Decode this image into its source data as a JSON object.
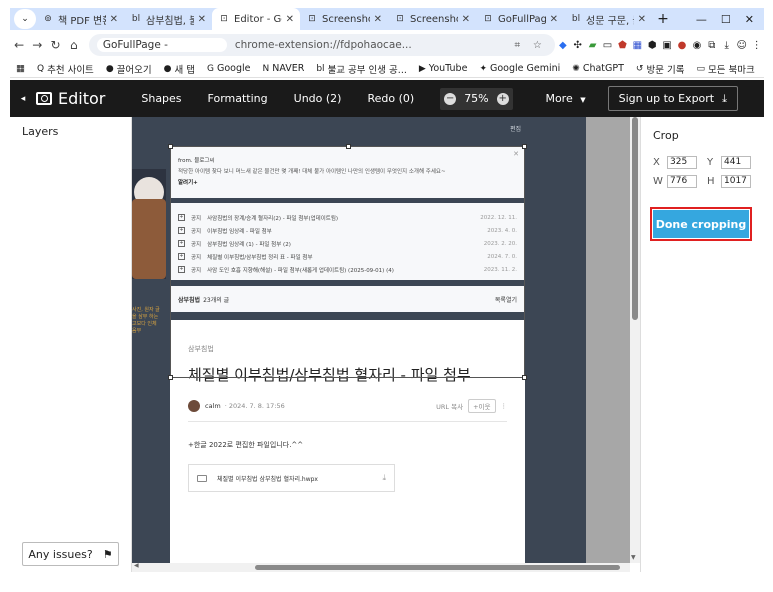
{
  "browser": {
    "tabs": [
      {
        "icon": "⊚",
        "label": "책 PDF 변환",
        "active": false
      },
      {
        "icon": "bl",
        "label": "삼부침법, 불",
        "active": false
      },
      {
        "icon": "⊡",
        "label": "Editor - GoF",
        "active": true
      },
      {
        "icon": "⊡",
        "label": "Screenshot",
        "active": false
      },
      {
        "icon": "⊡",
        "label": "Screenshot",
        "active": false
      },
      {
        "icon": "⊡",
        "label": "GoFullPage",
        "active": false
      },
      {
        "icon": "bl",
        "label": "성문 구문, 불",
        "active": false
      }
    ],
    "omnibox": {
      "site": "GoFullPage -",
      "url": "chrome-extension://fdpohaocae..."
    },
    "bookmarks": [
      {
        "icon": "Q",
        "label": "추천 사이트"
      },
      {
        "icon": "●",
        "label": "끌어오기"
      },
      {
        "icon": "●",
        "label": "새 탭"
      },
      {
        "icon": "G",
        "label": "Google"
      },
      {
        "icon": "N",
        "label": "NAVER"
      },
      {
        "icon": "bl",
        "label": "불교 공부 인생 공..."
      },
      {
        "icon": "▶",
        "label": "YouTube"
      },
      {
        "icon": "✦",
        "label": "Google Gemini"
      },
      {
        "icon": "✺",
        "label": "ChatGPT"
      },
      {
        "icon": "↺",
        "label": "방문 기록"
      }
    ],
    "bookmarks_all": "모든 북마크"
  },
  "editor": {
    "title": "Editor",
    "menu": {
      "shapes": "Shapes",
      "formatting": "Formatting",
      "undo": "Undo (2)",
      "redo": "Redo (0)"
    },
    "zoom": "75%",
    "more": "More",
    "export": "Sign up to Export"
  },
  "layers": {
    "title": "Layers",
    "issues": "Any issues?"
  },
  "canvas": {
    "badge": "편집",
    "card1": {
      "from": "from. 블로그씨",
      "desc": "적당한 아이템 찾다 보니 머느새 같은 물건만 몇 개째! 대체 불가 아이템인 나만의 인생템이 무엇인지 소개해 주세요~",
      "more": "알려기+"
    },
    "list": [
      {
        "cat": "공지",
        "title": "사암침법의 장계/승계 혈자리(2) - 파일 첨부(업데이트됨)",
        "date": "2022. 12. 11."
      },
      {
        "cat": "공지",
        "title": "이부침법 임상례 - 파일 첨부",
        "date": "2023. 4. 0."
      },
      {
        "cat": "공지",
        "title": "삼부침법 임상례 (1) - 파일 첨부 (2)",
        "date": "2023. 2. 20."
      },
      {
        "cat": "공지",
        "title": "체질별 이부침법/삼부침법 정리 표 - 파일 첨부",
        "date": "2024. 7. 0."
      },
      {
        "cat": "공지",
        "title": "사암 도인 호흡 지향해(해설) - 파일 첨부(새롭게 업데이트됨) (2025-09-01) (4)",
        "date": "2023. 11. 2."
      }
    ],
    "card3": {
      "cat": "삼부침법",
      "count": "23개의 글",
      "toggle": "목록열기"
    },
    "post": {
      "category": "삼부침법",
      "title": "체질별 이부침법/삼부침법 혈자리 - 파일 첨부",
      "author": "calm",
      "date": "· 2024. 7. 8. 17:56",
      "url_copy": "URL 복사",
      "neighbor": "+이웃",
      "body": "+한글 2022로 편집한 파일입니다.^^",
      "attachment": "체질별 이부침법 삼부침법 혈자리.hwpx"
    },
    "side_note": "사진, 원자 글을 삼부 하는 고보다 인체 음부"
  },
  "crop": {
    "title": "Crop",
    "x_label": "X",
    "x": "325",
    "y_label": "Y",
    "y": "441",
    "w_label": "W",
    "w": "776",
    "h_label": "H",
    "h": "1017",
    "done": "Done cropping"
  }
}
